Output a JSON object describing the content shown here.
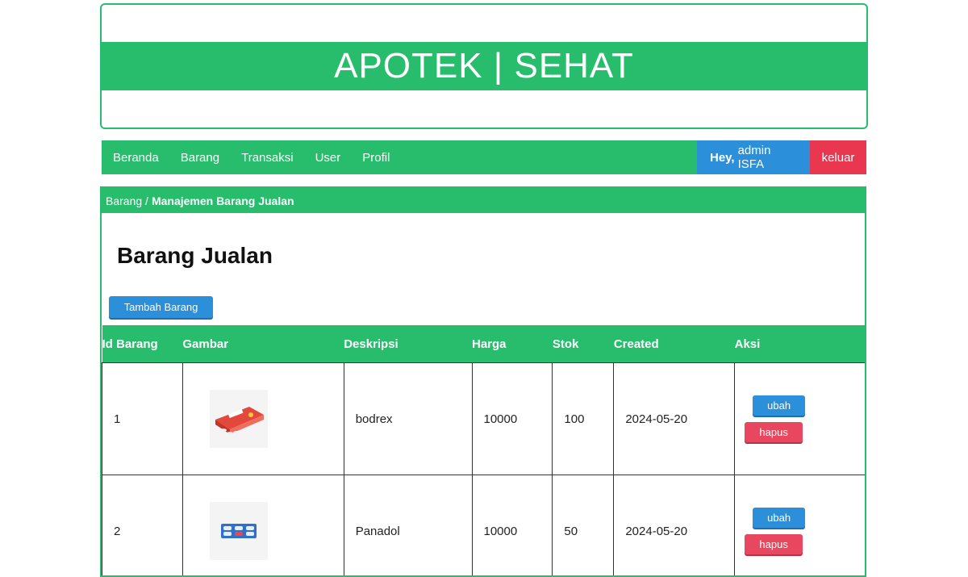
{
  "header": {
    "title": "APOTEK | SEHAT"
  },
  "nav": {
    "items": [
      "Beranda",
      "Barang",
      "Transaksi",
      "User",
      "Profil"
    ],
    "greeting": "Hey,",
    "user": "admin ISFA",
    "logout": "keluar"
  },
  "breadcrumb": {
    "parent": "Barang /",
    "current": "Manajemen Barang Jualan"
  },
  "page": {
    "title": "Barang Jualan",
    "add_button": "Tambah Barang"
  },
  "table": {
    "headers": [
      "Id Barang",
      "Gambar",
      "Deskripsi",
      "Harga",
      "Stok",
      "Created",
      "Aksi"
    ],
    "rows": [
      {
        "id": "1",
        "image": "bodrex-box",
        "desc": "bodrex",
        "harga": "10000",
        "stok": "100",
        "created": "2024-05-20",
        "edit": "ubah",
        "delete": "hapus"
      },
      {
        "id": "2",
        "image": "panadol-strip",
        "desc": "Panadol",
        "harga": "10000",
        "stok": "50",
        "created": "2024-05-20",
        "edit": "ubah",
        "delete": "hapus"
      }
    ]
  },
  "colors": {
    "primary": "#27bd6c",
    "info": "#2b8fd9",
    "danger": "#e8374f"
  }
}
